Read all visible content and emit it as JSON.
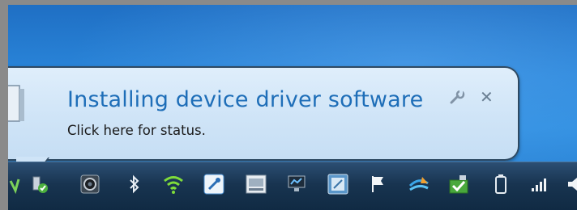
{
  "notification": {
    "title": "Installing device driver software",
    "subtitle": "Click here for status.",
    "options_icon": "wrench-icon",
    "close_icon": "close-icon",
    "device_icon": "device-icon"
  },
  "tray": {
    "icons": [
      "usb-safely-remove-icon",
      "webcam-icon",
      "bluetooth-icon",
      "wifi-icon",
      "tools-icon",
      "window-manager-icon",
      "network-monitor-icon",
      "settings-app-icon",
      "action-center-flag-icon",
      "sync-icon",
      "device-install-icon",
      "battery-icon",
      "signal-strength-icon",
      "volume-icon"
    ]
  },
  "colors": {
    "title": "#1e6eb8",
    "balloon": "#d4e7f8",
    "taskbar": "#183450",
    "desktop": "#2a86da"
  }
}
